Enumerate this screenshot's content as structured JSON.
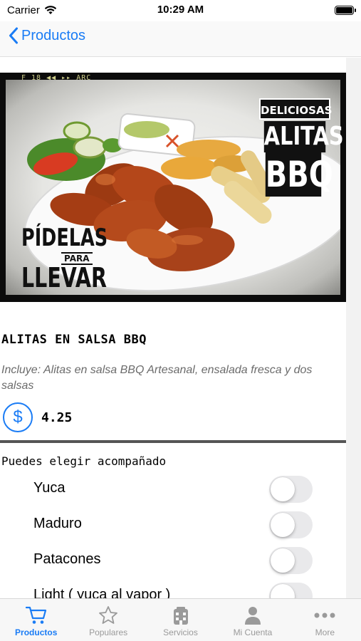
{
  "status": {
    "carrier": "Carrier",
    "time": "10:29 AM"
  },
  "nav": {
    "back_label": "Productos"
  },
  "hero": {
    "strip_text": "F 18   ◀◀   ▸▸ ARC",
    "badge_top": "DELICIOSAS",
    "badge_main_1": "ALITAS",
    "badge_main_2": "BBQ",
    "badge_left_1": "PÍDELAS",
    "badge_left_2": "PARA",
    "badge_left_3": "LLEVAR"
  },
  "product": {
    "name": "ALITAS EN SALSA BBQ",
    "description": "Incluye: Alitas en salsa BBQ Artesanal, ensalada fresca y dos salsas",
    "currency_symbol": "$",
    "price": "4.25"
  },
  "options": {
    "title": "Puedes elegir acompañado",
    "items": [
      {
        "label": "Yuca",
        "on": false
      },
      {
        "label": "Maduro",
        "on": false
      },
      {
        "label": "Patacones",
        "on": false
      },
      {
        "label": "Light ( yuca al vapor )",
        "on": false
      }
    ]
  },
  "tabs": [
    {
      "label": "Productos",
      "icon": "cart-icon",
      "active": true
    },
    {
      "label": "Populares",
      "icon": "star-icon",
      "active": false
    },
    {
      "label": "Servicios",
      "icon": "building-icon",
      "active": false
    },
    {
      "label": "Mi Cuenta",
      "icon": "person-icon",
      "active": false
    },
    {
      "label": "More",
      "icon": "more-icon",
      "active": false
    }
  ],
  "colors": {
    "accent": "#1a7cf5",
    "toggle_off": "#e9e9eb",
    "tab_inactive": "#9a9a9a"
  }
}
